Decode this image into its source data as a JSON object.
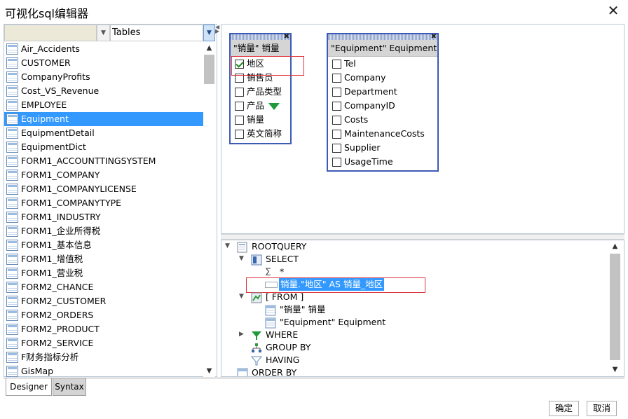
{
  "window": {
    "title": "可视化sql编辑器",
    "close_glyph": "✕"
  },
  "left_panel": {
    "combo_left_value": "",
    "combo_right_value": "Tables",
    "tables": [
      "Air_Accidents",
      "CUSTOMER",
      "CompanyProfits",
      "Cost_VS_Revenue",
      "EMPLOYEE",
      "Equipment",
      "EquipmentDetail",
      "EquipmentDict",
      "FORM1_ACCOUNTTINGSYSTEM",
      "FORM1_COMPANY",
      "FORM1_COMPANYLICENSE",
      "FORM1_COMPANYTYPE",
      "FORM1_INDUSTRY",
      "FORM1_企业所得税",
      "FORM1_基本信息",
      "FORM1_增值税",
      "FORM1_营业税",
      "FORM2_CHANCE",
      "FORM2_CUSTOMER",
      "FORM2_ORDERS",
      "FORM2_PRODUCT",
      "FORM2_SERVICE",
      "F财务指标分析",
      "GisMap"
    ],
    "selected_table": "Equipment"
  },
  "tabs": {
    "designer": "Designer",
    "syntax": "Syntax"
  },
  "table_boxes": {
    "sales": {
      "header": "\"销量\" 销量",
      "fields": [
        {
          "name": "地区",
          "checked": true
        },
        {
          "name": "销售员",
          "checked": false
        },
        {
          "name": "产品类型",
          "checked": false
        },
        {
          "name": "产品",
          "checked": false,
          "filter": true
        },
        {
          "name": "销量",
          "checked": false
        },
        {
          "name": "英文简称",
          "checked": false
        }
      ]
    },
    "equipment": {
      "header": "\"Equipment\" Equipment",
      "fields": [
        {
          "name": "Tel",
          "checked": false
        },
        {
          "name": "Company",
          "checked": false
        },
        {
          "name": "Department",
          "checked": false
        },
        {
          "name": "CompanyID",
          "checked": false
        },
        {
          "name": "Costs",
          "checked": false
        },
        {
          "name": "MaintenanceCosts",
          "checked": false
        },
        {
          "name": "Supplier",
          "checked": false
        },
        {
          "name": "UsageTime",
          "checked": false
        }
      ]
    }
  },
  "query_tree": {
    "root": "ROOTQUERY",
    "select": "SELECT",
    "star": "*",
    "selected_expr": "销量.\"地区\" AS 销量_地区",
    "from": "[ FROM ]",
    "from_tables": [
      "\"销量\" 销量",
      "\"Equipment\" Equipment"
    ],
    "where": "WHERE",
    "group_by": "GROUP BY",
    "having": "HAVING",
    "order_by": "ORDER BY"
  },
  "buttons": {
    "ok": "确定",
    "cancel": "取消"
  },
  "colors": {
    "selection": "#3399ff",
    "table_box_border": "#3b5bb5",
    "highlight_box": "#e0303a",
    "filter_green": "#1f9a3a"
  }
}
